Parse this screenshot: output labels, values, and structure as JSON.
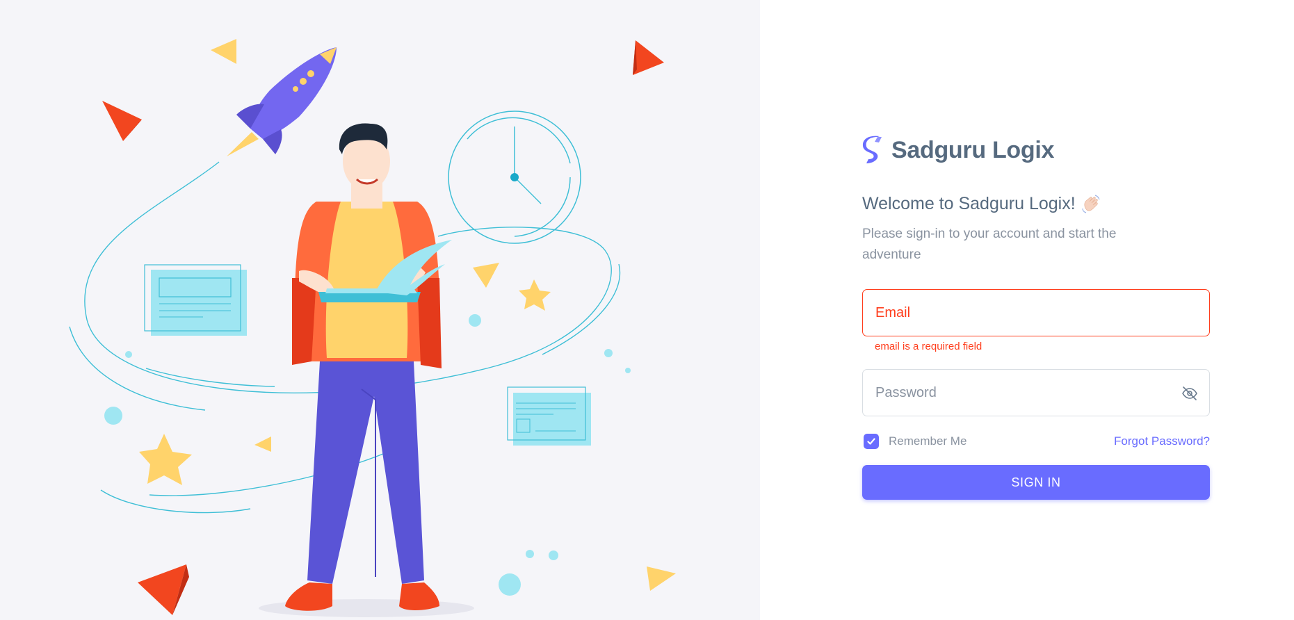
{
  "brand": {
    "name": "Sadguru Logix",
    "logo_icon": "s-logo-icon"
  },
  "welcome": {
    "title": "Welcome to Sadguru Logix!",
    "icon": "waving-hand-icon"
  },
  "subtitle": "Please sign-in to your account and start the adventure",
  "form": {
    "email": {
      "placeholder": "Email",
      "error": "email is a required field"
    },
    "password": {
      "placeholder": "Password",
      "toggle_icon": "eye-off-icon"
    },
    "remember": {
      "label": "Remember Me",
      "checked": true
    },
    "forgot_label": "Forgot Password?",
    "submit_label": "SIGN IN"
  },
  "colors": {
    "primary": "#696cff",
    "error": "#ff3e1d",
    "heading": "#566a7f",
    "muted": "#8a93a0",
    "illustration_bg": "#f5f5f9"
  }
}
